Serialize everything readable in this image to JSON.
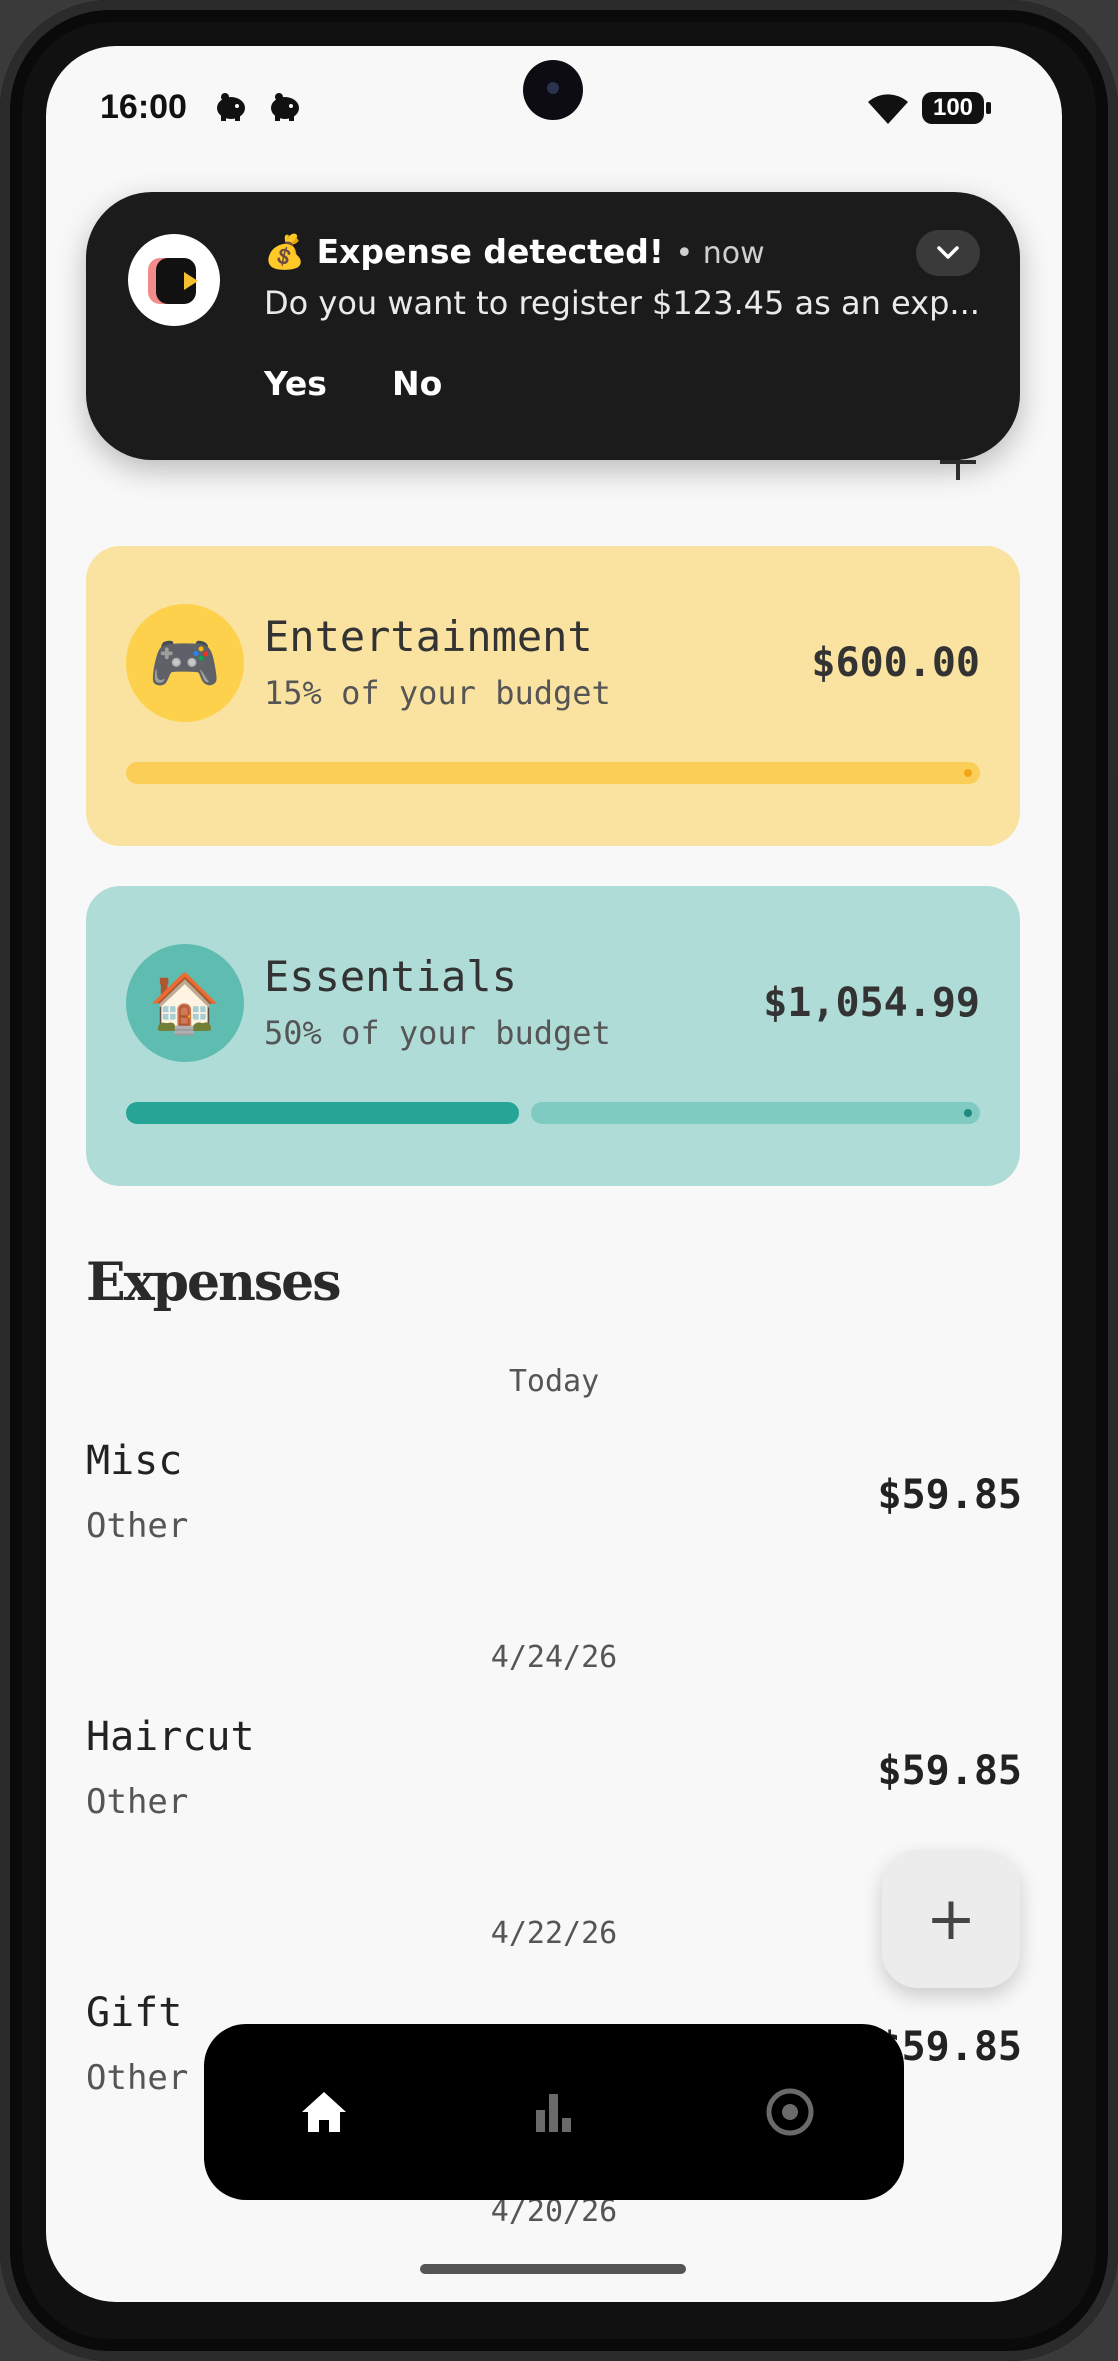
{
  "status_bar": {
    "time": "16:00",
    "battery": "100"
  },
  "notification": {
    "emoji": "💰",
    "title": "Expense detected!",
    "meta": "• now",
    "body": "Do you want to register $123.45 as an exp...",
    "actions": {
      "yes": "Yes",
      "no": "No"
    }
  },
  "budgets": [
    {
      "emoji": "🎮",
      "name": "Entertainment",
      "share": "15% of your budget",
      "amount": "$600.00",
      "progress": 0.0,
      "color": "#fae3a1"
    },
    {
      "emoji": "🏠",
      "name": "Essentials",
      "share": "50% of your budget",
      "amount": "$1,054.99",
      "progress": 0.46,
      "color": "#b0dcd8"
    }
  ],
  "expenses": {
    "title": "Expenses",
    "groups": [
      {
        "date": "Today",
        "items": [
          {
            "name": "Misc",
            "category": "Other",
            "amount": "$59.85"
          }
        ]
      },
      {
        "date": "4/24/26",
        "items": [
          {
            "name": "Haircut",
            "category": "Other",
            "amount": "$59.85"
          }
        ]
      },
      {
        "date": "4/22/26",
        "items": [
          {
            "name": "Gift",
            "category": "Other",
            "amount": "$59.85"
          }
        ]
      },
      {
        "date": "4/20/26",
        "items": []
      }
    ]
  },
  "fab": {
    "icon": "plus-icon",
    "label": "+"
  },
  "nav": {
    "items": [
      {
        "icon": "home-icon",
        "active": true
      },
      {
        "icon": "bar-chart-icon",
        "active": false
      },
      {
        "icon": "target-icon",
        "active": false
      }
    ]
  },
  "colors": {
    "accent_yellow": "#fdd14c",
    "accent_teal": "#26a596",
    "nav_bg": "#000000"
  }
}
